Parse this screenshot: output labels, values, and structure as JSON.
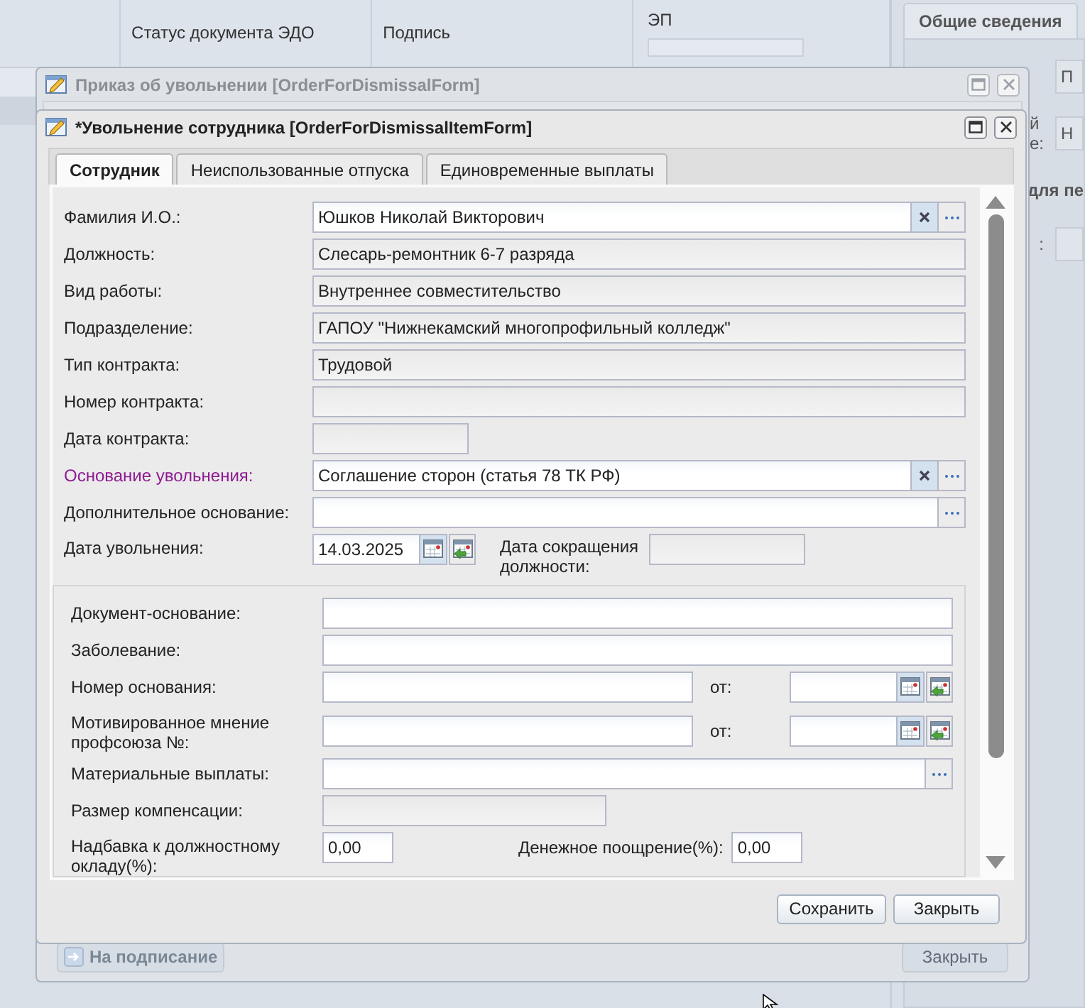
{
  "background": {
    "columns": [
      "Статус документа ЭДО",
      "Подпись",
      "ЭП"
    ],
    "side_tab": {
      "label": "Общие сведения",
      "selected": true
    },
    "side_rows": [
      {
        "label": "",
        "value": "П"
      },
      {
        "label": "й\nе:",
        "value": "Н"
      },
      {
        "label": "для пе",
        "value": ""
      },
      {
        "label": ":",
        "value": ""
      }
    ]
  },
  "outer_window": {
    "title": "Приказ об увольнении [OrderForDismissalForm]",
    "active": false,
    "buttons": [
      {
        "label": "На подписание",
        "disabled": true
      },
      {
        "label": "Закрыть",
        "disabled": false
      }
    ]
  },
  "window": {
    "title": "*Увольнение сотрудника [OrderForDismissalItemForm]",
    "active": true,
    "tabs": [
      {
        "label": "Сотрудник",
        "selected": true
      },
      {
        "label": "Неиспользованные отпуска",
        "selected": false
      },
      {
        "label": "Единовременные выплаты",
        "selected": false
      }
    ],
    "fields": [
      {
        "kind": "lookup",
        "label": "Фамилия И.О.:",
        "value": "Юшков Николай Викторович",
        "required": false
      },
      {
        "kind": "readonly",
        "label": "Должность:",
        "value": "Слесарь-ремонтник 6-7 разряда",
        "required": false
      },
      {
        "kind": "readonly",
        "label": "Вид работы:",
        "value": "Внутреннее совместительство",
        "required": false
      },
      {
        "kind": "readonly",
        "label": "Подразделение:",
        "value": "ГАПОУ \"Нижнекамский многопрофильный колледж\"",
        "required": false
      },
      {
        "kind": "readonly",
        "label": "Тип контракта:",
        "value": "Трудовой",
        "required": false
      },
      {
        "kind": "readonly",
        "label": "Номер контракта:",
        "required": false
      },
      {
        "kind": "readonly_short",
        "label": "Дата контракта:",
        "required": false
      },
      {
        "kind": "lookup",
        "label": "Основание увольнения:",
        "value": "Соглашение сторон (статья 78 ТК РФ)",
        "required": true
      },
      {
        "kind": "picker",
        "label": "Дополнительное основание:",
        "required": false
      },
      {
        "kind": "date_pair",
        "label": "Дата увольнения:",
        "value": "14.03.2025",
        "second_label": "Дата сокращения должности:",
        "required": false
      }
    ],
    "group_fields": [
      {
        "kind": "text",
        "label": "Документ-основание:"
      },
      {
        "kind": "text",
        "label": "Заболевание:"
      },
      {
        "kind": "text_date",
        "label": "Номер основания:",
        "date_label": "от:"
      },
      {
        "kind": "text_date",
        "label": "Мотивированное мнение профсоюза №:",
        "date_label": "от:"
      },
      {
        "kind": "picker",
        "label": "Материальные выплаты:"
      },
      {
        "kind": "readonly_medium",
        "label": "Размер компенсации:"
      },
      {
        "kind": "number_pair",
        "label": "Надбавка к должностному окладу(%):",
        "value": "0,00",
        "second_label": "Денежное поощрение(%):",
        "second_value": "0,00"
      }
    ],
    "buttons": [
      "Сохранить",
      "Закрыть"
    ]
  }
}
